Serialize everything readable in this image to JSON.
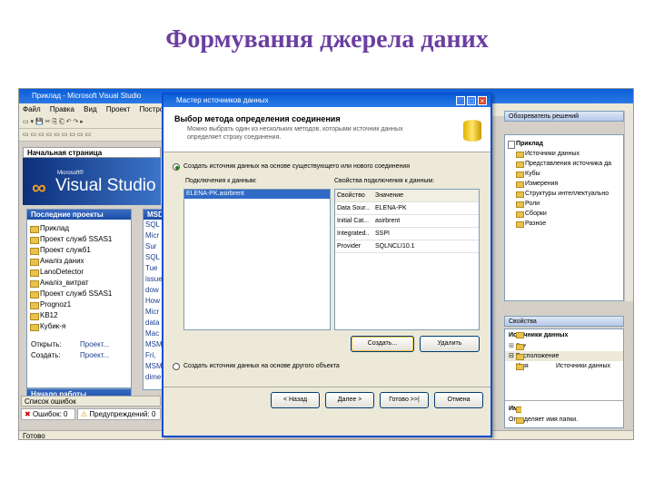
{
  "slide": {
    "title": "Формування джерела даних"
  },
  "vs": {
    "window_title": "Приклад - Microsoft Visual Studio",
    "menu": [
      "Файл",
      "Правка",
      "Вид",
      "Проект",
      "Построения"
    ],
    "start_tab": "Начальная страница",
    "banner_small": "Microsoft®",
    "banner_big": "Visual Studio 20",
    "recent_header": "Последние проекты",
    "recent_projects": [
      "Приклад",
      "Проект служб SSAS1",
      "Проект служб1",
      "Аналіз даних",
      "LanoDetector",
      "Аналіз_витрат",
      "Проект служб SSAS1",
      "Prognoz1",
      "KB12",
      "Кубик-я"
    ],
    "open_label": "Открыть:",
    "open_link": "Проект...",
    "create_label": "Создать:",
    "create_link": "Проект...",
    "start_work_header": "Начало работы",
    "msdn_header": "MSD",
    "msdn_lines": [
      "SQL",
      "Micr",
      "Sur",
      "SQL",
      "Tue",
      "issue",
      "dow",
      "How",
      "Micr",
      "data",
      "Mac",
      "MSM",
      "Fri,",
      "MSM",
      "dime"
    ],
    "errors_header": "Список ошибок",
    "errors_btn": "Ошибок: 0",
    "warnings_btn": "Предупреждений: 0",
    "status_text": "Готово"
  },
  "dialog": {
    "title": "Мастер источников данных",
    "heading": "Выбор метода определения соединения",
    "description": "Можно выбрать один из нескольких методов, которыми источник данных определяет строку соединения.",
    "radio1": "Создать источник данных на основе существующего или нового соединения",
    "radio2": "Создать источник данных на основе другого объекта",
    "connections_label": "Подключения к данным:",
    "connections_selected": "ELENA-PK.asirbrent",
    "properties_label": "Свойства подключения к данным:",
    "properties_header": {
      "name": "Свойство",
      "value": "Значение"
    },
    "properties": [
      {
        "name": "Data Sour...",
        "value": "ELENA-PK"
      },
      {
        "name": "Initial Cat...",
        "value": "asirbrent"
      },
      {
        "name": "Integrated...",
        "value": "SSPI"
      },
      {
        "name": "Provider",
        "value": "SQLNCLI10.1"
      }
    ],
    "create_btn": "Создать...",
    "delete_btn": "Удалить",
    "back_btn": "< Назад",
    "next_btn": "Далее >",
    "finish_btn": "Готово >>|",
    "cancel_btn": "Отмена"
  },
  "solution": {
    "header": "Обозреватель решений",
    "root": "Приклад",
    "items": [
      "Источники данных",
      "Представления источника да",
      "Кубы",
      "Измерения",
      "Структуры интеллектуально",
      "Роли",
      "Сборки",
      "Разное"
    ]
  },
  "properties_panel": {
    "header": "Свойства",
    "object": "Источники данных",
    "section": "Расположение",
    "row_name": "Имя",
    "row_value": "Источники данных",
    "desc_title": "Имя",
    "desc_text": "Определяет имя папки."
  }
}
